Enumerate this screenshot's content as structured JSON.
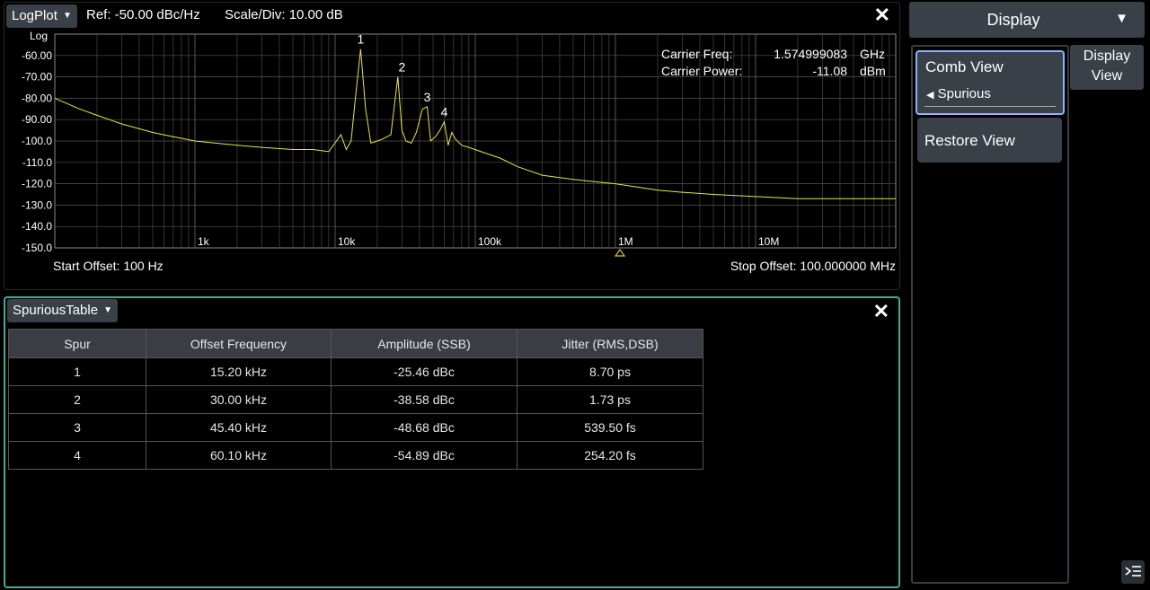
{
  "plot": {
    "dropdown_label": "LogPlot",
    "ref": "Ref: -50.00 dBc/Hz",
    "scale": "Scale/Div: 10.00 dB",
    "start_offset": "Start Offset: 100 Hz",
    "stop_offset": "Stop Offset: 100.000000 MHz",
    "carrier_freq_label": "Carrier Freq:",
    "carrier_freq_value": "1.574999083",
    "carrier_freq_unit": "GHz",
    "carrier_power_label": "Carrier Power:",
    "carrier_power_value": "-11.08",
    "carrier_power_unit": "dBm",
    "close_icon": "close-icon"
  },
  "chart_data": {
    "type": "line",
    "log_x": true,
    "xlim": [
      100,
      100000000
    ],
    "ylim": [
      -150,
      -50
    ],
    "y_axis_label": "Log",
    "y_ticks": [
      "-60.00",
      "-70.00",
      "-80.00",
      "-90.00",
      "-100.0",
      "-110.0",
      "-120.0",
      "-130.0",
      "-140.0",
      "-150.0"
    ],
    "x_ticks": [
      {
        "x": 1000,
        "label": "1k"
      },
      {
        "x": 10000,
        "label": "10k"
      },
      {
        "x": 100000,
        "label": "100k"
      },
      {
        "x": 1000000,
        "label": "1M"
      },
      {
        "x": 10000000,
        "label": "10M"
      }
    ],
    "grid": true,
    "trace_color": "#e6e64a",
    "spur_trace_color": "#3fbf3f",
    "series": [
      {
        "x": [
          100,
          150,
          200,
          300,
          500,
          700,
          1000,
          2000,
          3000,
          5000,
          7000,
          9000,
          11000,
          12000,
          13000,
          14000,
          15200,
          16500,
          18000,
          20000,
          22000,
          25000,
          28000,
          30000,
          32000,
          35000,
          38000,
          42000,
          45400,
          48000,
          52000,
          56000,
          60100,
          64000,
          68000,
          72000,
          80000,
          90000,
          110000,
          150000,
          200000,
          300000,
          500000,
          700000,
          1000000,
          2000000,
          3000000,
          5000000,
          10000000,
          20000000,
          50000000,
          100000000
        ],
        "y": [
          -80,
          -85,
          -88,
          -92,
          -96,
          -98,
          -100,
          -102,
          -103,
          -104,
          -104,
          -105,
          -97,
          -104,
          -100,
          -79,
          -57,
          -85,
          -101,
          -100,
          -99,
          -97,
          -70,
          -95,
          -100,
          -101,
          -96,
          -85,
          -84,
          -100,
          -98,
          -95,
          -91,
          -102,
          -96,
          -99,
          -102,
          -103,
          -105,
          -108,
          -112,
          -116,
          -118,
          -119,
          -120,
          -123,
          -124,
          -125,
          -126,
          -127,
          -127,
          -127
        ]
      }
    ],
    "markers": [
      {
        "label": "1",
        "x": 15200,
        "y": -57
      },
      {
        "label": "2",
        "x": 30000,
        "y": -70
      },
      {
        "label": "3",
        "x": 45400,
        "y": -84
      },
      {
        "label": "4",
        "x": 60100,
        "y": -91
      }
    ]
  },
  "table": {
    "dropdown_label": "SpuriousTable",
    "headers": [
      "Spur",
      "Offset Frequency",
      "Amplitude (SSB)",
      "Jitter (RMS,DSB)"
    ],
    "rows": [
      [
        "1",
        "15.20 kHz",
        "-25.46 dBc",
        "8.70 ps"
      ],
      [
        "2",
        "30.00 kHz",
        "-38.58 dBc",
        "1.73 ps"
      ],
      [
        "3",
        "45.40 kHz",
        "-48.68 dBc",
        "539.50 fs"
      ],
      [
        "4",
        "60.10 kHz",
        "-54.89 dBc",
        "254.20 fs"
      ]
    ]
  },
  "right": {
    "menu_label": "Display",
    "comb_view": "Comb View",
    "comb_sub": "Spurious",
    "restore_view": "Restore View",
    "tab_display_line1": "Display",
    "tab_display_line2": "View"
  }
}
